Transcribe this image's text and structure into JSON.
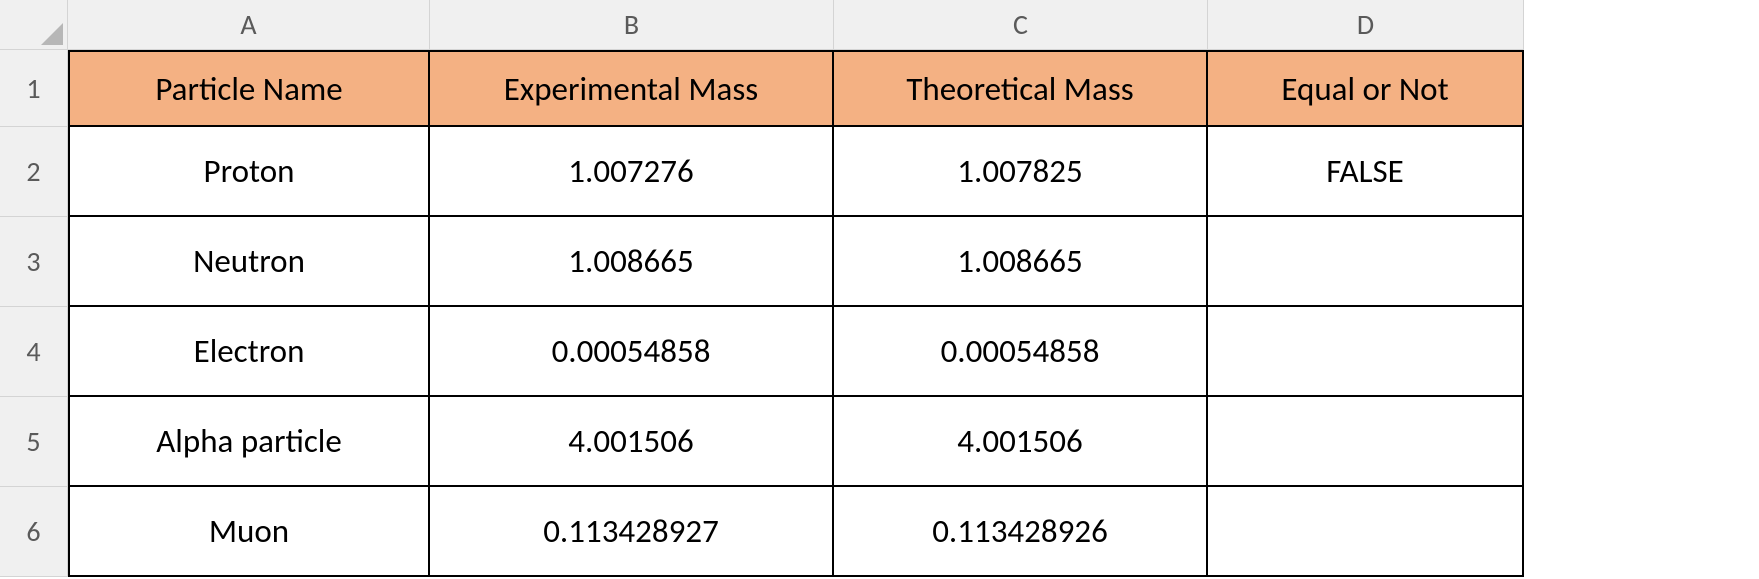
{
  "columns": [
    "A",
    "B",
    "C",
    "D"
  ],
  "rowNumbers": [
    "1",
    "2",
    "3",
    "4",
    "5",
    "6"
  ],
  "headers": {
    "A": "Particle Name",
    "B": "Experimental Mass",
    "C": "Theoretical Mass",
    "D": "Equal or Not"
  },
  "rows": [
    {
      "A": "Proton",
      "B": "1.007276",
      "C": "1.007825",
      "D": "FALSE"
    },
    {
      "A": "Neutron",
      "B": "1.008665",
      "C": "1.008665",
      "D": ""
    },
    {
      "A": "Electron",
      "B": "0.00054858",
      "C": "0.00054858",
      "D": ""
    },
    {
      "A": "Alpha particle",
      "B": "4.001506",
      "C": "4.001506",
      "D": ""
    },
    {
      "A": "Muon",
      "B": "0.113428927",
      "C": "0.113428926",
      "D": ""
    }
  ],
  "chart_data": {
    "type": "table",
    "title": "",
    "columns": [
      "Particle Name",
      "Experimental Mass",
      "Theoretical Mass",
      "Equal or Not"
    ],
    "data": [
      [
        "Proton",
        1.007276,
        1.007825,
        "FALSE"
      ],
      [
        "Neutron",
        1.008665,
        1.008665,
        ""
      ],
      [
        "Electron",
        0.00054858,
        0.00054858,
        ""
      ],
      [
        "Alpha particle",
        4.001506,
        4.001506,
        ""
      ],
      [
        "Muon",
        0.113428927,
        0.113428926,
        ""
      ]
    ]
  }
}
